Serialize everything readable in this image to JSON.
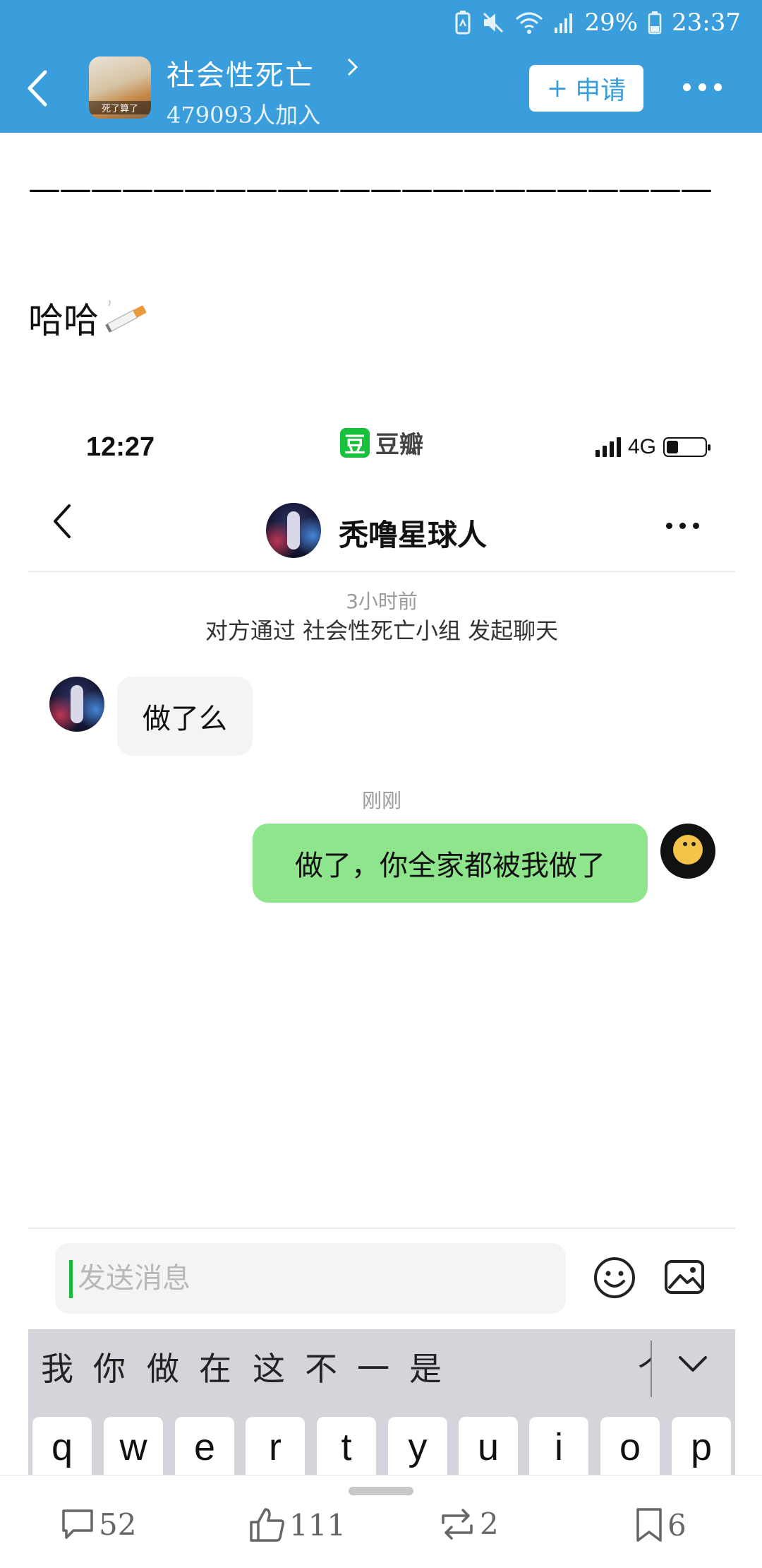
{
  "status_bar": {
    "battery": "29%",
    "time": "23:37"
  },
  "group": {
    "name": "社会性死亡",
    "members": "479093人加入",
    "avatar_caption": "死了算了",
    "apply_label": "申请"
  },
  "post": {
    "dashes": "——————————————————————",
    "text": "哈哈"
  },
  "screenshot": {
    "time": "12:27",
    "app_logo": "豆",
    "app_name": "豆瓣",
    "network": "4G",
    "chat_title": "秃噜星球人",
    "ts1": "3小时前",
    "system_msg": "对方通过 社会性死亡小组 发起聊天",
    "msg_in": "做了么",
    "ts2": "刚刚",
    "msg_out": "做了，你全家都被我做了",
    "input_placeholder": "发送消息",
    "candidates": [
      "我",
      "你",
      "做",
      "在",
      "这",
      "不",
      "一",
      "是",
      "个"
    ],
    "keys": [
      "q",
      "w",
      "e",
      "r",
      "t",
      "y",
      "u",
      "i",
      "o",
      "p"
    ]
  },
  "actions": {
    "comments": "52",
    "likes": "111",
    "reposts": "2",
    "bookmarks": "6"
  },
  "colors": {
    "header": "#3b9edc",
    "bubble_out": "#8ee58c",
    "bubble_in": "#f4f4f4",
    "douban": "#17c13b"
  },
  "icons": [
    "back-arrow-icon",
    "chevron-right-icon",
    "more-icon",
    "cigarette-icon",
    "signal-icon",
    "battery-icon",
    "emoji-icon",
    "image-icon",
    "keyboard-collapse-icon",
    "comment-icon",
    "like-icon",
    "repost-icon",
    "bookmark-icon"
  ]
}
